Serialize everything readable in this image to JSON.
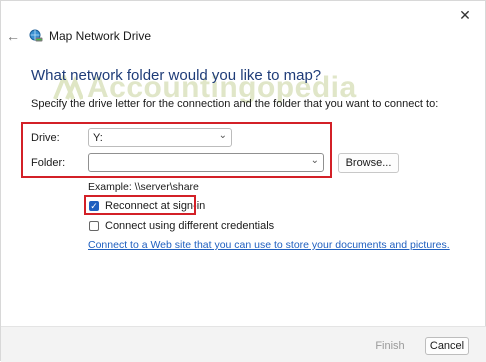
{
  "window": {
    "title": "Map Network Drive",
    "close_glyph": "✕",
    "back_glyph": "←"
  },
  "watermark": {
    "text": "Accountingopedia"
  },
  "heading": "What network folder would you like to map?",
  "instruction": "Specify the drive letter for the connection and the folder that you want to connect to:",
  "drive": {
    "label": "Drive:",
    "value": "Y:"
  },
  "folder": {
    "label": "Folder:",
    "value": "",
    "browse_label": "Browse..."
  },
  "example": "Example: \\\\server\\share",
  "options": {
    "reconnect": {
      "label": "Reconnect at sign-in",
      "checked": true
    },
    "credentials": {
      "label": "Connect using different credentials",
      "checked": false
    }
  },
  "link": "Connect to a Web site that you can use to store your documents and pictures.",
  "footer": {
    "finish_label": "Finish",
    "cancel_label": "Cancel"
  },
  "colors": {
    "highlight_border": "#d32027",
    "heading": "#1f3c78",
    "link": "#1f5fbf",
    "checkbox_checked": "#1f5fbf"
  },
  "icons": {
    "title": "network-drive-icon",
    "dropdown": "chevron-down-icon",
    "check": "checkmark-icon"
  }
}
